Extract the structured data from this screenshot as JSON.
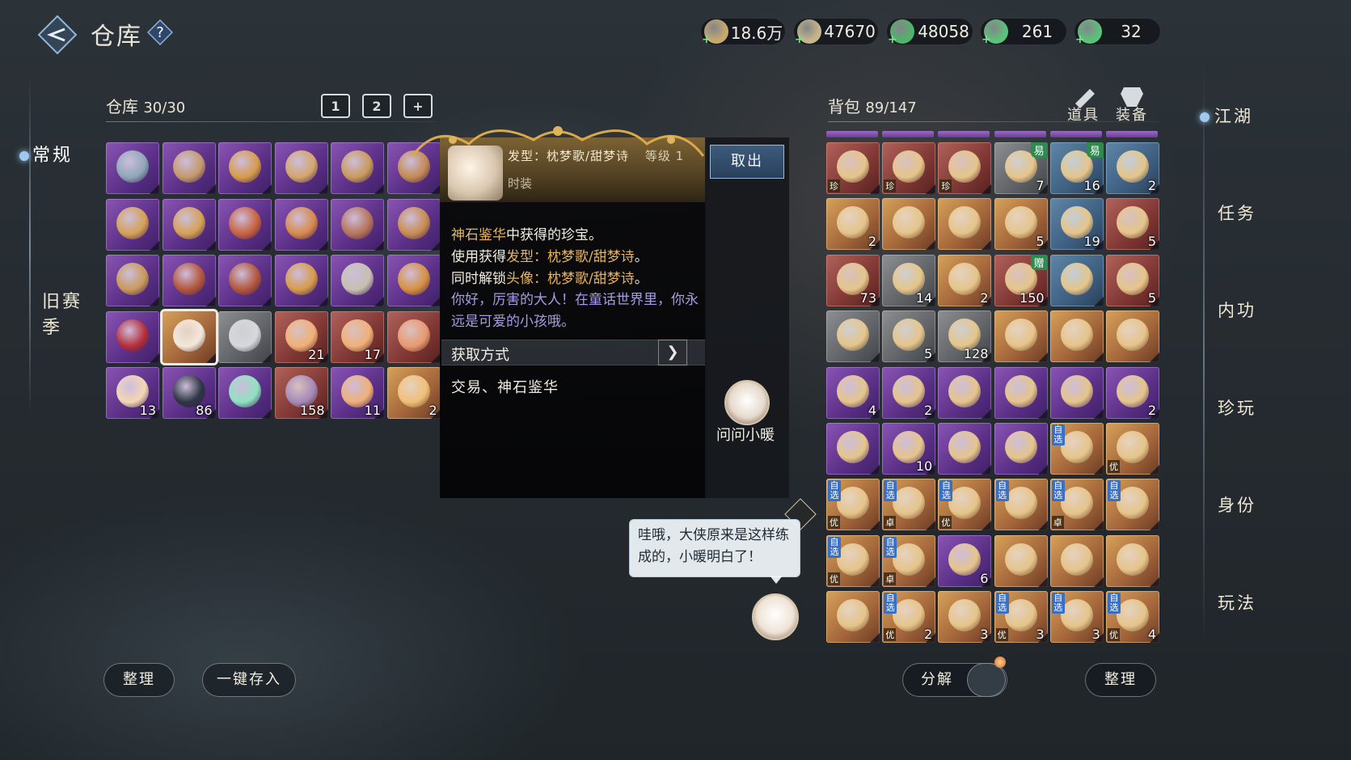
{
  "header": {
    "title": "仓库",
    "help": "?",
    "currencies": [
      {
        "icon": "scroll-currency-icon",
        "value": "18.6万",
        "color": "#c9a86e"
      },
      {
        "icon": "silver-coin-icon",
        "value": "47670",
        "color": "#c7b58c"
      },
      {
        "icon": "jade-coin-icon",
        "value": "48058",
        "color": "#4fb36b"
      },
      {
        "icon": "jade-coin-2-icon",
        "value": "261",
        "color": "#5bc27a"
      },
      {
        "icon": "jade-coin-3-icon",
        "value": "32",
        "color": "#5bc27a"
      }
    ]
  },
  "left_nav": {
    "items": [
      {
        "label": "常规",
        "active": true
      },
      {
        "label": "旧赛\n季",
        "active": false
      }
    ]
  },
  "warehouse": {
    "label": "仓库",
    "count": "30/30",
    "tabs": [
      "1",
      "2",
      "+"
    ],
    "items": [
      {
        "rarity": "purple",
        "icon": "boots-icon",
        "count": "",
        "art": "#8fa7b8"
      },
      {
        "rarity": "purple",
        "icon": "necklace-icon",
        "count": "",
        "art": "#c49a6c"
      },
      {
        "rarity": "purple",
        "icon": "bracer-icon",
        "count": "",
        "art": "#d79b4a"
      },
      {
        "rarity": "purple",
        "icon": "necklace-icon",
        "count": "",
        "art": "#d4a66a"
      },
      {
        "rarity": "purple",
        "icon": "necklace-icon",
        "count": "",
        "art": "#c99a5a"
      },
      {
        "rarity": "purple",
        "icon": "necklace-icon",
        "count": "",
        "art": "#c48a52"
      },
      {
        "rarity": "purple",
        "icon": "ring-icon",
        "count": "",
        "art": "#d6a153"
      },
      {
        "rarity": "purple",
        "icon": "ring-icon",
        "count": "",
        "art": "#d6a153"
      },
      {
        "rarity": "purple",
        "icon": "ring-icon",
        "count": "",
        "art": "#c8623f"
      },
      {
        "rarity": "purple",
        "icon": "ring-icon",
        "count": "",
        "art": "#d88a4a"
      },
      {
        "rarity": "purple",
        "icon": "ring-icon",
        "count": "",
        "art": "#b8745a"
      },
      {
        "rarity": "purple",
        "icon": "ring-icon",
        "count": "",
        "art": "#c98c4e"
      },
      {
        "rarity": "purple",
        "icon": "ring-icon",
        "count": "",
        "art": "#c99a5a"
      },
      {
        "rarity": "purple",
        "icon": "boots-icon",
        "count": "",
        "art": "#b3563b"
      },
      {
        "rarity": "purple",
        "icon": "boots-icon",
        "count": "",
        "art": "#b3563b"
      },
      {
        "rarity": "purple",
        "icon": "gauntlet-icon",
        "count": "",
        "art": "#d79b4a"
      },
      {
        "rarity": "purple",
        "icon": "gauntlet-icon",
        "count": "",
        "art": "#c8c0b0"
      },
      {
        "rarity": "purple",
        "icon": "gauntlet-icon",
        "count": "",
        "art": "#d7903f"
      },
      {
        "rarity": "purple",
        "icon": "belt-icon",
        "count": "",
        "art": "#b52e3a"
      },
      {
        "rarity": "gold",
        "icon": "hairstyle-icon",
        "count": "",
        "art": "#f3e8dc",
        "selected": true
      },
      {
        "rarity": "grey",
        "icon": "robe-icon",
        "count": "",
        "art": "#d5d8de"
      },
      {
        "rarity": "red",
        "icon": "voucher-icon",
        "count": "21",
        "art": "#f1b078"
      },
      {
        "rarity": "red",
        "icon": "voucher-icon",
        "count": "17",
        "art": "#f1b078"
      },
      {
        "rarity": "red",
        "icon": "voucher-icon",
        "count": "",
        "art": "#e99a70"
      },
      {
        "rarity": "purple",
        "icon": "pearl-icon",
        "count": "13",
        "art": "#f5d7b4"
      },
      {
        "rarity": "purple",
        "icon": "talisman-icon",
        "count": "86",
        "art": "#2d3542"
      },
      {
        "rarity": "purple",
        "icon": "jade-box-icon",
        "count": "",
        "art": "#8fe3c0"
      },
      {
        "rarity": "red",
        "icon": "bowl-icon",
        "count": "158",
        "art": "#a58ab8"
      },
      {
        "rarity": "purple",
        "icon": "voucher-icon",
        "count": "11",
        "art": "#f1b078"
      },
      {
        "rarity": "gold",
        "icon": "voucher-icon",
        "count": "2",
        "art": "#f1c078"
      }
    ]
  },
  "tooltip": {
    "type_line": "发型：枕梦歌/甜梦诗",
    "level": "等级 1",
    "category": "时装",
    "desc_parts": [
      {
        "text": "神石鉴华",
        "hl": true
      },
      {
        "text": "中获得的珍宝。\n使用获得",
        "hl": false
      },
      {
        "text": "发型：枕梦歌/甜梦诗",
        "hl": true
      },
      {
        "text": "。\n同时解锁",
        "hl": false
      },
      {
        "text": "头像：枕梦歌/甜梦诗",
        "hl": true
      },
      {
        "text": "。",
        "hl": false
      }
    ],
    "flavor": "你好，厉害的大人！在童话世界里，你永远是可爱的小孩哦。",
    "get_label": "获取方式",
    "get_btn": "❯",
    "source": "交易、神石鉴华",
    "take_out": "取出",
    "ask_label": "问问小暖"
  },
  "bubble": {
    "text": "哇哦，大侠原来是这样练成的，小暖明白了！"
  },
  "backpack": {
    "label": "背包",
    "count": "89/147",
    "filters": [
      "道具",
      "装备"
    ],
    "items": [
      {
        "rarity": "red",
        "icon": "bracelet-icon",
        "count": "",
        "bl": "珍"
      },
      {
        "rarity": "red",
        "icon": "belt-icon",
        "count": "",
        "bl": "珍"
      },
      {
        "rarity": "red",
        "icon": "scroll-icon",
        "count": "",
        "bl": "珍"
      },
      {
        "rarity": "grey",
        "icon": "tea-icon",
        "count": "7",
        "tr": "易"
      },
      {
        "rarity": "blue",
        "icon": "bowl-icon",
        "count": "16",
        "tr": "易"
      },
      {
        "rarity": "blue",
        "icon": "heart-icon",
        "count": "2"
      },
      {
        "rarity": "gold",
        "icon": "pearl-icon",
        "count": "2"
      },
      {
        "rarity": "gold",
        "icon": "pearl-icon",
        "count": ""
      },
      {
        "rarity": "gold",
        "icon": "orb-icon",
        "count": ""
      },
      {
        "rarity": "gold",
        "icon": "rabbit-coin-icon",
        "count": "5"
      },
      {
        "rarity": "blue",
        "icon": "vase-icon",
        "count": "19"
      },
      {
        "rarity": "red",
        "icon": "pot-icon",
        "count": "5"
      },
      {
        "rarity": "red",
        "icon": "map-icon",
        "count": "73"
      },
      {
        "rarity": "grey",
        "icon": "rice-icon",
        "count": "14"
      },
      {
        "rarity": "gold",
        "icon": "barrel-icon",
        "count": "2"
      },
      {
        "rarity": "red",
        "icon": "ore-icon",
        "count": "150",
        "tr": "赠"
      },
      {
        "rarity": "blue",
        "icon": "fan-icon",
        "count": ""
      },
      {
        "rarity": "red",
        "icon": "scroll-icon",
        "count": "5"
      },
      {
        "rarity": "grey",
        "icon": "boat-icon",
        "count": ""
      },
      {
        "rarity": "grey",
        "icon": "scroll-icon",
        "count": "5"
      },
      {
        "rarity": "grey",
        "icon": "bamboo-icon",
        "count": "128"
      },
      {
        "rarity": "gold",
        "icon": "compass-icon",
        "count": ""
      },
      {
        "rarity": "gold",
        "icon": "chest-icon",
        "count": ""
      },
      {
        "rarity": "gold",
        "icon": "chest-icon",
        "count": ""
      },
      {
        "rarity": "purple",
        "icon": "coral-icon",
        "count": "4"
      },
      {
        "rarity": "purple",
        "icon": "flute-icon",
        "count": "2"
      },
      {
        "rarity": "purple",
        "icon": "armor-icon",
        "count": ""
      },
      {
        "rarity": "purple",
        "icon": "armor-icon",
        "count": ""
      },
      {
        "rarity": "purple",
        "icon": "spirit-icon",
        "count": ""
      },
      {
        "rarity": "purple",
        "icon": "flag-icon",
        "count": "2"
      },
      {
        "rarity": "purple",
        "icon": "box-icon",
        "count": ""
      },
      {
        "rarity": "purple",
        "icon": "jade-icon",
        "count": "10"
      },
      {
        "rarity": "purple",
        "icon": "armor-icon",
        "count": ""
      },
      {
        "rarity": "purple",
        "icon": "armor-icon",
        "count": ""
      },
      {
        "rarity": "gold",
        "icon": "chest-icon",
        "count": "",
        "tl": "自选"
      },
      {
        "rarity": "gold",
        "icon": "chest-icon",
        "count": "",
        "bl": "优"
      },
      {
        "rarity": "gold",
        "icon": "chest-icon",
        "count": "",
        "tl": "自选",
        "bl": "优"
      },
      {
        "rarity": "gold",
        "icon": "chest-icon",
        "count": "",
        "tl": "自选",
        "bl": "卓"
      },
      {
        "rarity": "gold",
        "icon": "chest-icon",
        "count": "",
        "tl": "自选",
        "bl": "优"
      },
      {
        "rarity": "gold",
        "icon": "chest-icon",
        "count": "",
        "tl": "自选"
      },
      {
        "rarity": "gold",
        "icon": "chest-icon",
        "count": "",
        "tl": "自选",
        "bl": "卓"
      },
      {
        "rarity": "gold",
        "icon": "chest-icon",
        "count": "",
        "tl": "自选"
      },
      {
        "rarity": "gold",
        "icon": "chest-icon",
        "count": "",
        "tl": "自选",
        "bl": "优"
      },
      {
        "rarity": "gold",
        "icon": "chest-icon",
        "count": "",
        "tl": "自选",
        "bl": "卓"
      },
      {
        "rarity": "purple",
        "icon": "gourd-icon",
        "count": "6"
      },
      {
        "rarity": "gold",
        "icon": "zongzi-icon",
        "count": ""
      },
      {
        "rarity": "gold",
        "icon": "card-icon",
        "count": ""
      },
      {
        "rarity": "gold",
        "icon": "portrait-icon",
        "count": ""
      },
      {
        "rarity": "gold",
        "icon": "chest-icon",
        "count": ""
      },
      {
        "rarity": "gold",
        "icon": "chest-icon",
        "count": "2",
        "tl": "自选",
        "bl": "优"
      },
      {
        "rarity": "gold",
        "icon": "red-book-icon",
        "count": "3"
      },
      {
        "rarity": "gold",
        "icon": "chest-icon",
        "count": "3",
        "tl": "自选",
        "bl": "优"
      },
      {
        "rarity": "gold",
        "icon": "chest-icon",
        "count": "3",
        "tl": "自选"
      },
      {
        "rarity": "gold",
        "icon": "chest-icon",
        "count": "4",
        "tl": "自选",
        "bl": "优"
      }
    ]
  },
  "right_nav": [
    "江湖",
    "任务",
    "内功",
    "珍玩",
    "身份",
    "玩法"
  ],
  "buttons": {
    "sort_left": "整理",
    "deposit_all": "一键存入",
    "decompose": "分解",
    "sort_right": "整理"
  }
}
